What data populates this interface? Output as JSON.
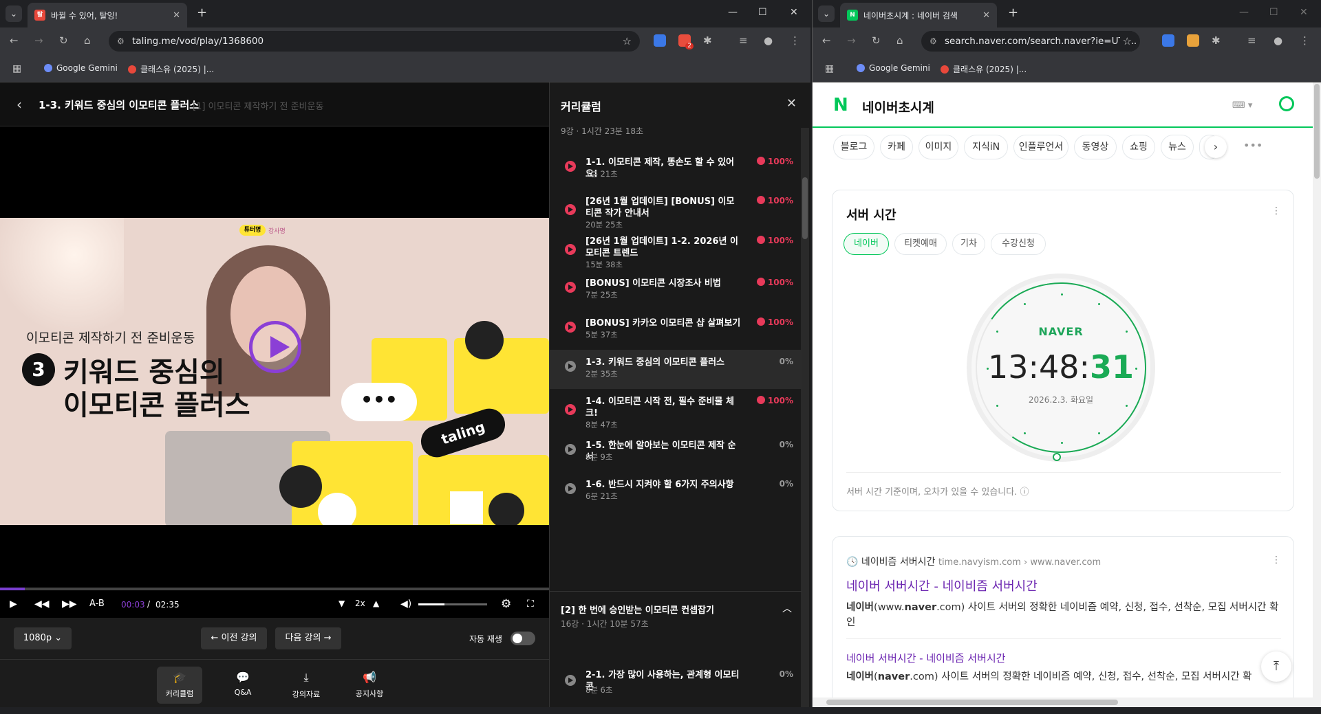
{
  "left_window": {
    "tab_title": "바뀔 수 있어, 탈잉!",
    "tab_favicon": "탈",
    "url": "taling.me/vod/play/1368600",
    "bookmarks": [
      "Google Gemini",
      "클래스유 (2025) |..."
    ],
    "ext_badge": "2",
    "lecture_title": "1-3. 키워드 중심의 이모티콘 플러스",
    "lecture_section": "[1] 이모티콘 제작하기 전 준비운동",
    "thumbnail": {
      "badge": "튜터명",
      "badge2": "강사명",
      "subtitle": "이모티콘 제작하기 전 준비운동",
      "number": "3",
      "line1": "키워드 중심의",
      "line2": "이모티콘 플러스",
      "bubble": "•••",
      "brand": "taling"
    },
    "player": {
      "progress": 0.02,
      "ab": "A-B",
      "current": "00:03",
      "sep": "/",
      "total": "02:35",
      "speed": "2x",
      "volume": 0.38
    },
    "quality": "1080p",
    "prev_label": "이전 강의",
    "next_label": "다음 강의",
    "autoplay_label": "자동 재생",
    "nav": [
      "커리큘럼",
      "Q&A",
      "강의자료",
      "공지사항"
    ]
  },
  "curriculum": {
    "title": "커리큘럼",
    "meta": "9강 · 1시간 23분 18초",
    "items": [
      {
        "name": "1-1. 이모티콘 제작, 똥손도 할 수 있어요!",
        "dur": "7분 21초",
        "pct": "100%"
      },
      {
        "name": "[26년 1월 업데이트] [BONUS] 이모티콘 작가 안내서",
        "dur": "20분 25초",
        "pct": "100%"
      },
      {
        "name": "[26년 1월 업데이트] 1-2. 2026년 이모티콘 트렌드",
        "dur": "15분 38초",
        "pct": "100%"
      },
      {
        "name": "[BONUS] 이모티콘 시장조사 비법",
        "dur": "7분 25초",
        "pct": "100%"
      },
      {
        "name": "[BONUS] 카카오 이모티콘 샵 살펴보기",
        "dur": "5분 37초",
        "pct": "100%"
      },
      {
        "name": "1-3. 키워드 중심의 이모티콘 플러스",
        "dur": "2분 35초",
        "pct": "0%"
      },
      {
        "name": "1-4. 이모티콘 시작 전, 필수 준비물 체크!",
        "dur": "8분 47초",
        "pct": "100%"
      },
      {
        "name": "1-5. 한눈에 알아보는 이모티콘 제작 순서",
        "dur": "9분 9초",
        "pct": "0%"
      },
      {
        "name": "1-6. 반드시 지켜야 할 6가지 주의사항",
        "dur": "6분 21초",
        "pct": "0%"
      }
    ],
    "section2": {
      "title": "[2] 한 번에 승인받는 이모티콘 컨셉잡기",
      "meta": "16강 · 1시간 10분 57초"
    },
    "item2": {
      "name": "2-1. 가장 많이 사용하는, 관계형 이모티콘",
      "dur": "8분 6초",
      "pct": "0%"
    }
  },
  "right_window": {
    "tab_title": "네이버초시계 : 네이버 검색",
    "tab_favicon": "N",
    "url": "search.naver.com/search.naver?ie=UTF...",
    "bookmarks": [
      "Google Gemini",
      "클래스유 (2025) |..."
    ],
    "query": "네이버초시계",
    "chips": [
      "블로그",
      "카페",
      "이미지",
      "지식iN",
      "인플루언서",
      "동영상",
      "쇼핑",
      "뉴스",
      "쇼"
    ],
    "card_title": "서버 시간",
    "sub_tabs": [
      "네이버",
      "티켓예매",
      "기차",
      "수강신청"
    ],
    "clock_brand": "NAVER",
    "time_hm": "13:48:",
    "time_s": "31",
    "date": "2026.2.3. 화요일",
    "note": "서버 시간 기준이며, 오차가 있을 수 있습니다.",
    "result_site": "네이비즘 서버시간",
    "result_path": "time.navyism.com › www.naver.com",
    "result_title": "네이버 서버시간 - 네이비즘 서버시간",
    "result_desc_a": "네이버",
    "result_desc_b": "(www.",
    "result_desc_c": "naver",
    "result_desc_d": ".com) 사이트 서버의 정확한 네이비즘 예약, 신청, 접수, 선착순, 모집 서버시간 확인",
    "result2_title": "네이버 서버시간 - 네이비즘 서버시간",
    "result2_desc_a": "네이버",
    "result2_desc_b": "(",
    "result2_desc_c": "naver",
    "result2_desc_d": ".com) 사이트 서버의 정확한 네이비즘 예약, 신청, 접수, 선착순, 모집 서버시간 확"
  },
  "colors": {
    "accent_purple": "#8b3fd6",
    "done_red": "#e83a5a",
    "naver_green": "#03c75a"
  }
}
